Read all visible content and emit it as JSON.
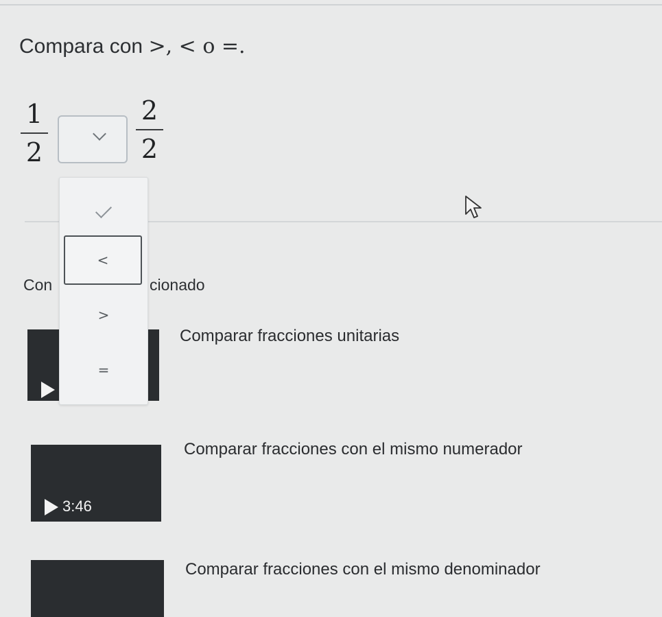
{
  "question": {
    "prefix": "Compara con ",
    "symbols": ">, < o =."
  },
  "comparison": {
    "left_fraction": {
      "numerator": "1",
      "denominator": "2"
    },
    "right_fraction": {
      "numerator": "2",
      "denominator": "2"
    }
  },
  "dropdown": {
    "options": [
      "<",
      ">",
      "="
    ],
    "highlighted": "<"
  },
  "section": {
    "status_left": "Con",
    "status_right": "cionado"
  },
  "videos": [
    {
      "title": "Comparar fracciones unitarias",
      "duration": ""
    },
    {
      "title": "Comparar fracciones con el mismo numerador",
      "duration": "3:46"
    },
    {
      "title": "Comparar fracciones con el mismo denominador",
      "duration": ""
    }
  ],
  "icons": {
    "select_chevron": "chevron-down-icon",
    "selected_marker": "check-icon",
    "play": "play-icon",
    "mouse_cursor": "cursor-icon"
  }
}
